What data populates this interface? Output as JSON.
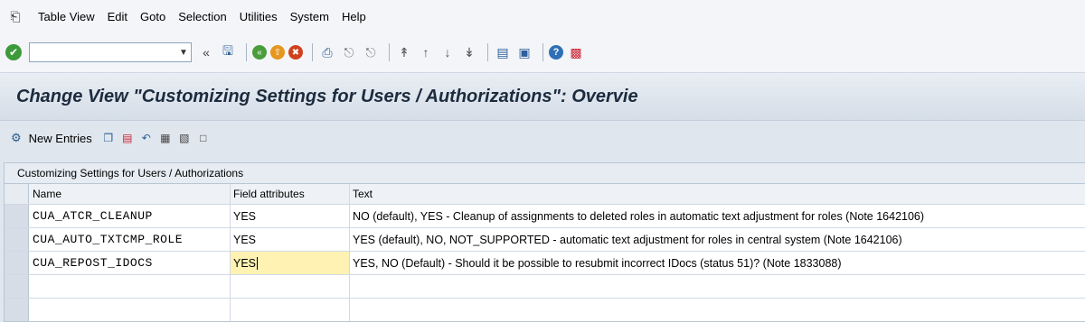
{
  "menubar": {
    "items": [
      "Table View",
      "Edit",
      "Goto",
      "Selection",
      "Utilities",
      "System",
      "Help"
    ]
  },
  "toolbar": {
    "command_field_value": "",
    "icons": [
      "enter-icon",
      "back-icon",
      "exit-icon",
      "cancel-icon",
      "print-icon",
      "find-icon",
      "find-next-icon",
      "first-page-icon",
      "previous-page-icon",
      "next-page-icon",
      "last-page-icon",
      "new-session-icon",
      "shortcut-icon",
      "help-icon",
      "layout-icon"
    ]
  },
  "title": "Change View \"Customizing Settings for Users / Authorizations\": Overvie",
  "app_toolbar": {
    "new_entries": "New Entries"
  },
  "table": {
    "title": "Customizing Settings for Users / Authorizations",
    "columns": [
      "Name",
      "Field attributes",
      "Text"
    ],
    "rows": [
      {
        "name": "CUA_ATCR_CLEANUP",
        "attr": "YES",
        "text": "NO (default), YES - Cleanup of assignments to deleted roles in automatic text adjustment for roles (Note 1642106)"
      },
      {
        "name": "CUA_AUTO_TXTCMP_ROLE",
        "attr": "YES",
        "text": "YES (default), NO, NOT_SUPPORTED - automatic text adjustment for roles in central system (Note 1642106)"
      },
      {
        "name": "CUA_REPOST_IDOCS",
        "attr": "YES",
        "text": "YES, NO (Default) - Should it be possible to resubmit incorrect IDocs (status 51)? (Note 1833088)"
      }
    ]
  },
  "colors": {
    "active_cell": "#fff2b3",
    "title_text": "#1c2b3d"
  }
}
